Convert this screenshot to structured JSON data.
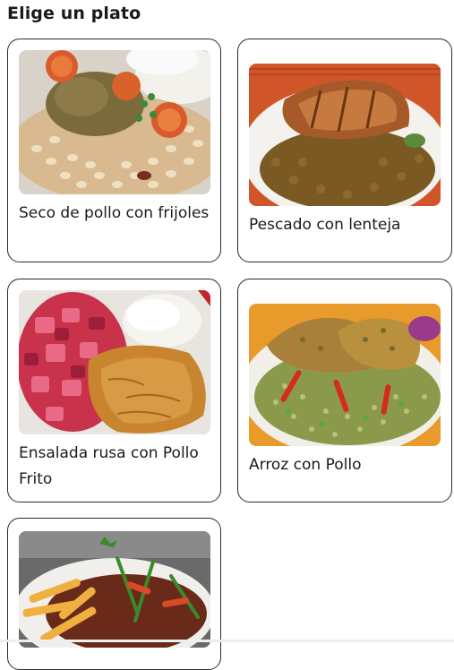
{
  "page": {
    "title": "Elige un plato"
  },
  "dishes": [
    {
      "name": "Seco de pollo con frijoles",
      "image_icon": "seco-de-pollo-image"
    },
    {
      "name": "Pescado con lenteja",
      "image_icon": "pescado-con-lenteja-image"
    },
    {
      "name": "Ensalada rusa con Pollo Frito",
      "image_icon": "ensalada-rusa-pollo-frito-image"
    },
    {
      "name": "Arroz con Pollo",
      "image_icon": "arroz-con-pollo-image"
    },
    {
      "name": "",
      "image_icon": "lomo-saltado-image"
    }
  ]
}
